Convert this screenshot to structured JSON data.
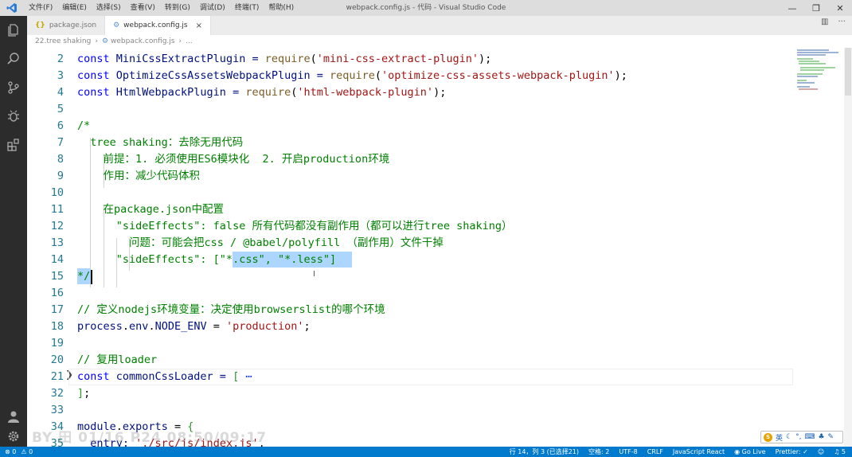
{
  "window": {
    "title": "webpack.config.js - 代码 - Visual Studio Code",
    "menus": [
      "文件(F)",
      "编辑(E)",
      "选择(S)",
      "查看(V)",
      "转到(G)",
      "调试(D)",
      "终端(T)",
      "帮助(H)"
    ]
  },
  "tabs": [
    {
      "label": "package.json",
      "icon": "{}"
    },
    {
      "label": "webpack.config.js",
      "icon": "⚙"
    }
  ],
  "breadcrumb": {
    "folder": "22.tree shaking",
    "file": "webpack.config.js",
    "trail": "..."
  },
  "editor": {
    "lines": [
      {
        "n": "2"
      },
      {
        "n": "3"
      },
      {
        "n": "4"
      },
      {
        "n": "5"
      },
      {
        "n": "6"
      },
      {
        "n": "7"
      },
      {
        "n": "8"
      },
      {
        "n": "9"
      },
      {
        "n": "10"
      },
      {
        "n": "11"
      },
      {
        "n": "12"
      },
      {
        "n": "13"
      },
      {
        "n": "14"
      },
      {
        "n": "15"
      },
      {
        "n": "16"
      },
      {
        "n": "17"
      },
      {
        "n": "18"
      },
      {
        "n": "19"
      },
      {
        "n": "20"
      },
      {
        "n": "21"
      },
      {
        "n": "32"
      },
      {
        "n": "33"
      },
      {
        "n": "34"
      },
      {
        "n": "35"
      }
    ],
    "text": {
      "l2a": "const",
      "l2b": " MiniCssExtractPlugin = ",
      "l2c": "require",
      "l2d": "(",
      "l2e": "'mini-css-extract-plugin'",
      "l2f": ");",
      "l3a": "const",
      "l3b": " OptimizeCssAssetsWebpackPlugin = ",
      "l3c": "require",
      "l3d": "(",
      "l3e": "'optimize-css-assets-webpack-plugin'",
      "l3f": ");",
      "l4a": "const",
      "l4b": " HtmlWebpackPlugin = ",
      "l4c": "require",
      "l4d": "(",
      "l4e": "'html-webpack-plugin'",
      "l4f": ");",
      "l6": "/*",
      "l7": "  tree shaking：去除无用代码",
      "l8": "    前提：1. 必须使用ES6模块化  2. 开启production环境",
      "l9": "    作用：减少代码体积",
      "l11": "    在package.json中配置",
      "l12": "      \"sideEffects\": false 所有代码都没有副作用（都可以进行tree shaking）",
      "l13": "        问题：可能会把css / @babel/polyfill （副作用）文件干掉",
      "l14": "      \"sideEffects\": [\"*.css\", \"*.less\"]",
      "l15": "*/",
      "l17": "// 定义nodejs环境变量：决定使用browserslist的哪个环境",
      "l18a": "process",
      "l18b": ".",
      "l18c": "env",
      "l18d": ".",
      "l18e": "NODE_ENV",
      "l18f": " = ",
      "l18g": "'production'",
      "l18h": ";",
      "l20": "// 复用loader",
      "l21a": "const",
      "l21b": " commonCssLoader = ",
      "l21c": "[",
      "l21d": " ⋯",
      "l32a": "]",
      "l32b": ";",
      "l34a": "module",
      "l34b": ".",
      "l34c": "exports",
      "l34d": " = ",
      "l34e": "{",
      "l35a": "  entry: ",
      "l35b": "'./src/js/index.js'",
      "l35c": ","
    }
  },
  "statusbar": {
    "errors": "0",
    "warnings": "0",
    "position": "行 14，列 3 (已选择21)",
    "spaces": "空格: 2",
    "encoding": "UTF-8",
    "eol": "CRLF",
    "language": "JavaScript React",
    "golive": "Go Live",
    "prettier": "Prettier: ✓",
    "notifications": "5"
  },
  "ime": {
    "logo": "S",
    "lang": "英"
  },
  "watermark": "BY 田 01/16 P24 08:50/09:17",
  "colors": {
    "statusbar": "#007acc",
    "activitybar": "#2c2c2c",
    "keyword": "#0000ff",
    "string": "#a31515",
    "comment": "#008000",
    "selection": "#add6ff"
  }
}
